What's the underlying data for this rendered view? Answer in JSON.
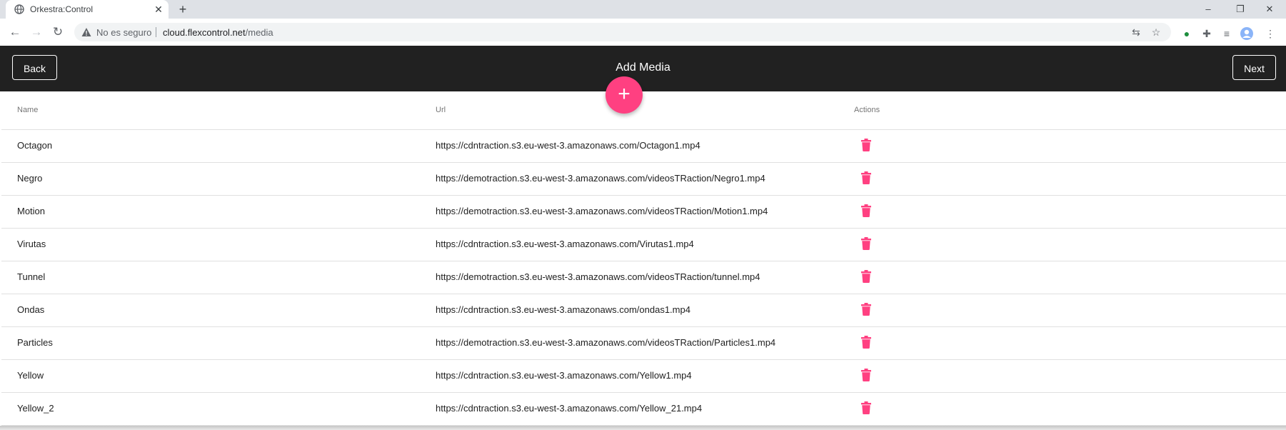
{
  "browser": {
    "tab_title": "Orkestra:Control",
    "tab_close": "✕",
    "new_tab": "+",
    "security_text": "No es seguro",
    "url_host": "cloud.flexcontrol.net",
    "url_path": "/media",
    "window_controls": {
      "minimize": "–",
      "restore": "❐",
      "close": "✕"
    }
  },
  "header": {
    "back_label": "Back",
    "title": "Add Media",
    "next_label": "Next",
    "fab_label": "+"
  },
  "table": {
    "columns": {
      "name": "Name",
      "url": "Url",
      "actions": "Actions"
    },
    "rows": [
      {
        "name": "Octagon",
        "url": "https://cdntraction.s3.eu-west-3.amazonaws.com/Octagon1.mp4"
      },
      {
        "name": "Negro",
        "url": "https://demotraction.s3.eu-west-3.amazonaws.com/videosTRaction/Negro1.mp4"
      },
      {
        "name": "Motion",
        "url": "https://demotraction.s3.eu-west-3.amazonaws.com/videosTRaction/Motion1.mp4"
      },
      {
        "name": "Virutas",
        "url": "https://cdntraction.s3.eu-west-3.amazonaws.com/Virutas1.mp4"
      },
      {
        "name": "Tunnel",
        "url": "https://demotraction.s3.eu-west-3.amazonaws.com/videosTRaction/tunnel.mp4"
      },
      {
        "name": "Ondas",
        "url": "https://cdntraction.s3.eu-west-3.amazonaws.com/ondas1.mp4"
      },
      {
        "name": "Particles",
        "url": "https://demotraction.s3.eu-west-3.amazonaws.com/videosTRaction/Particles1.mp4"
      },
      {
        "name": "Yellow",
        "url": "https://cdntraction.s3.eu-west-3.amazonaws.com/Yellow1.mp4"
      },
      {
        "name": "Yellow_2",
        "url": "https://cdntraction.s3.eu-west-3.amazonaws.com/Yellow_21.mp4"
      }
    ]
  },
  "colors": {
    "accent": "#ff4081",
    "header_bg": "#212121"
  },
  "icons": {
    "row_action": "trash-icon",
    "fab": "plus-icon",
    "favicon": "globe-icon",
    "security": "warning-icon"
  }
}
